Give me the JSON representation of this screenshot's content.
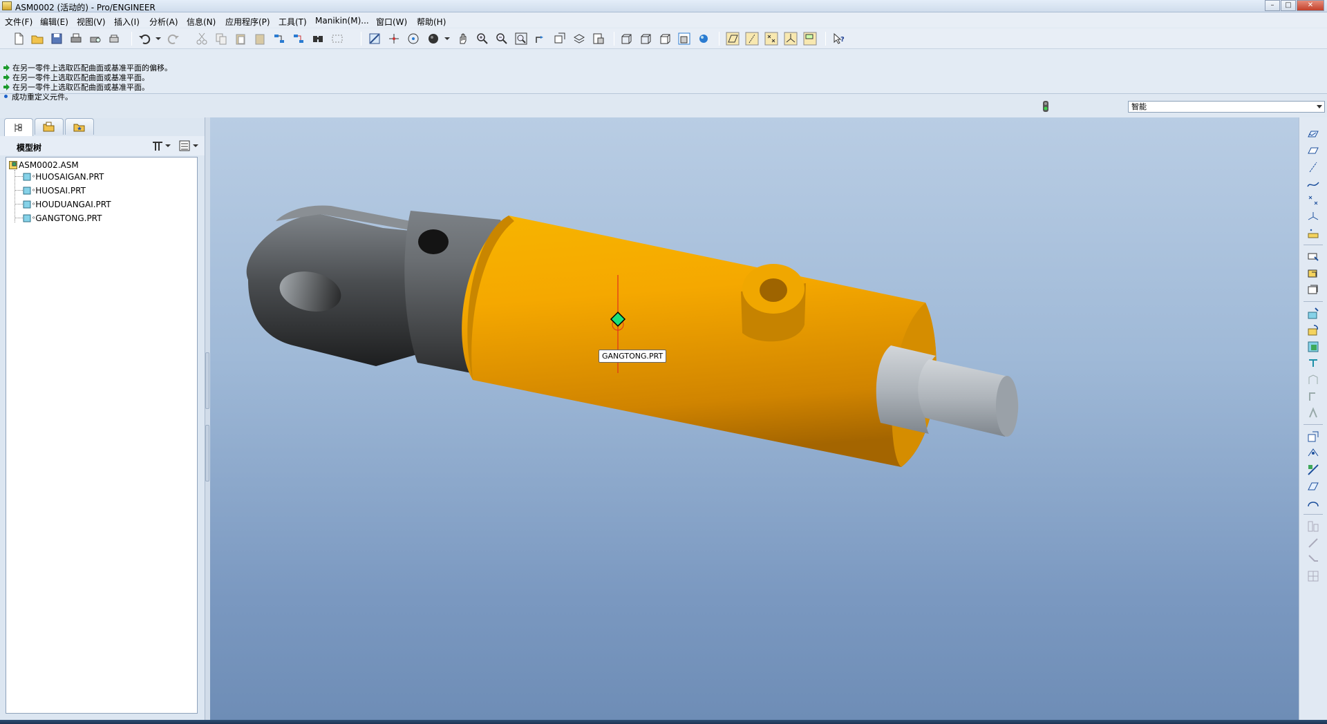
{
  "window": {
    "title": "ASM0002 (活动的) - Pro/ENGINEER",
    "minimize": "–",
    "maximize": "□",
    "close": "✕"
  },
  "menu": [
    "文件(F)",
    "编辑(E)",
    "视图(V)",
    "插入(I)",
    "分析(A)",
    "信息(N)",
    "应用程序(P)",
    "工具(T)",
    "Manikin(M)...",
    "窗口(W)",
    "帮助(H)"
  ],
  "messages": [
    {
      "icon": "green-arrow-icon",
      "text": "在另一零件上选取匹配曲面或基准平面的偏移。"
    },
    {
      "icon": "green-arrow-icon",
      "text": "在另一零件上选取匹配曲面或基准平面。"
    },
    {
      "icon": "green-arrow-icon",
      "text": "在另一零件上选取匹配曲面或基准平面。"
    },
    {
      "icon": "blue-dot-icon",
      "text": "成功重定义元件。"
    }
  ],
  "filter": {
    "selected": "智能"
  },
  "model_tree": {
    "title": "模型树",
    "root": "ASM0002.ASM",
    "items": [
      "HUOSAIGAN.PRT",
      "HUOSAI.PRT",
      "HOUDUANGAI.PRT",
      "GANGTONG.PRT"
    ]
  },
  "viewport": {
    "tooltip": "GANGTONG.PRT",
    "colors": {
      "cylinder": "#f2a200",
      "clevis": "#3a3a3a",
      "rod": "#b8c0c8",
      "selection": "#e0301c"
    }
  }
}
